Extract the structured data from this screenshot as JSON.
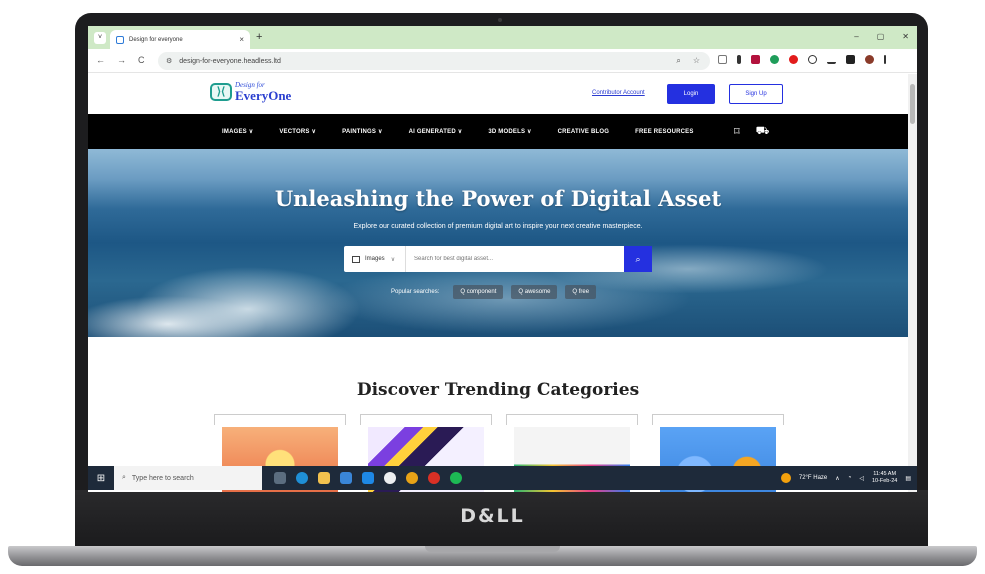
{
  "device": {
    "brand": "D&LL"
  },
  "browser": {
    "tab_title": "Design for everyone",
    "tab_close": "×",
    "new_tab": "+",
    "tab_menu": "˅",
    "window_controls": [
      "–",
      "▢",
      "✕"
    ],
    "url": "design-for-everyone.headless.ltd",
    "nav": {
      "back": "←",
      "forward": "→",
      "reload": "C"
    },
    "extensions": [
      "puzzle-icon",
      "pin-icon",
      "red-ext-icon",
      "green-ext-icon",
      "opera-icon",
      "sync-icon",
      "download-icon",
      "sidebar-icon",
      "profile-icon",
      "menu-icon"
    ]
  },
  "site": {
    "logo_small": "Design for",
    "logo_big": "EveryOne",
    "contributor_link": "Contributor Account",
    "login_label": "Login",
    "signup_label": "Sign Up",
    "menu": [
      "IMAGES ∨",
      "VECTORS ∨",
      "PAINTINGS ∨",
      "AI GENERATED ∨",
      "3D MODELS ∨",
      "CREATIVE BLOG",
      "FREE RESOURCES"
    ],
    "hero": {
      "title": "Unleashing the Power of Digital Asset",
      "subtitle": "Explore our curated collection of premium digital art to inspire your next creative masterpiece.",
      "search_category": "Images",
      "search_placeholder": "Search for best digital asset...",
      "popular_label": "Popular searches:",
      "popular_chips": [
        "Q  component",
        "Q  awesome",
        "Q  free"
      ]
    },
    "section_title": "Discover Trending Categories"
  },
  "taskbar": {
    "search_placeholder": "Type here to search",
    "weather": "72°F Haze",
    "time": "11:45 AM",
    "date": "10-Feb-24"
  },
  "colors": {
    "accent": "#2430e0",
    "menubar": "#000000",
    "tabbar": "#cfe9c6",
    "taskbar": "#1e2a3a"
  }
}
